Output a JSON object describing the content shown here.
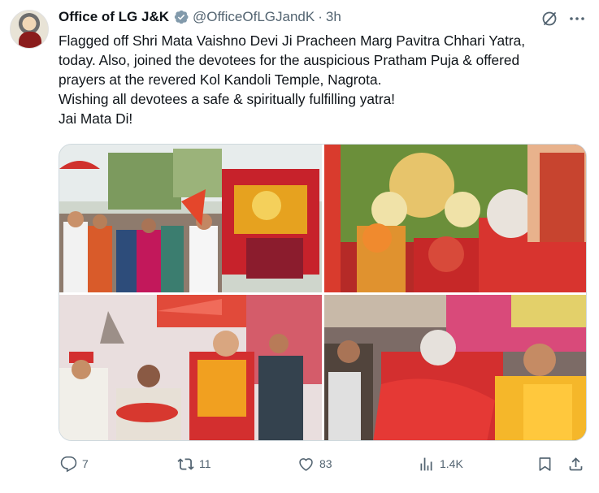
{
  "tweet": {
    "author_name": "Office of LG J&K",
    "handle": "@OfficeOfLGJandK",
    "separator": "·",
    "time": "3h",
    "verified_color": "#829aab",
    "text_lines": [
      "Flagged off Shri Mata Vaishno Devi Ji Pracheen Marg Pavitra Chhari Yatra,",
      "today. Also, joined the devotees for the auspicious Pratham Puja & offered",
      "prayers at the revered Kol Kandoli Temple, Nagrota.",
      "Wishing all devotees a safe & spiritually fulfilling yatra!",
      "Jai Mata Di!"
    ]
  },
  "media": {
    "photo_count": 4
  },
  "actions": {
    "replies": "7",
    "reposts": "11",
    "likes": "83",
    "views": "1.4K"
  },
  "icons": {
    "reply": "reply-icon",
    "repost": "repost-icon",
    "like": "heart-icon",
    "views": "views-chart-icon",
    "bookmark": "bookmark-icon",
    "share": "share-icon",
    "grok": "grok-icon",
    "more": "more-icon",
    "verified": "verified-badge-icon"
  },
  "colors": {
    "text": "#0f1419",
    "secondary": "#536471",
    "border": "#cfd9de"
  }
}
